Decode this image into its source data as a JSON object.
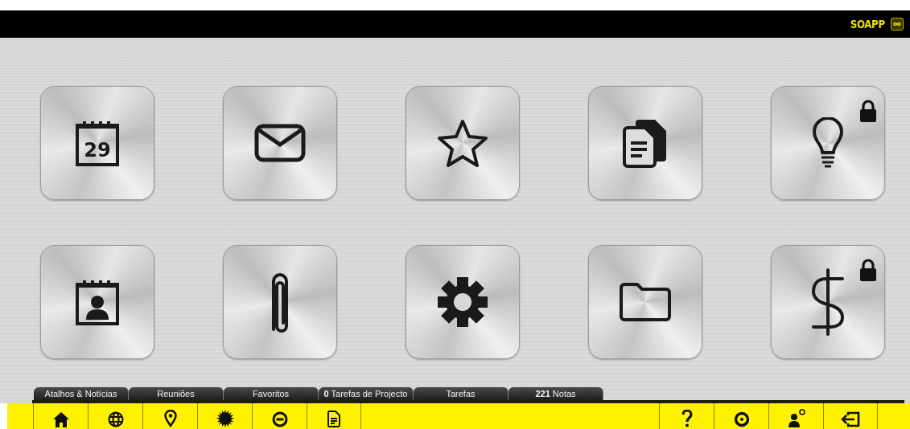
{
  "header": {
    "logo": "SOAPP"
  },
  "tiles": [
    {
      "kind": "calendar",
      "day": "29",
      "locked": false
    },
    {
      "kind": "mail",
      "locked": false
    },
    {
      "kind": "star",
      "locked": false
    },
    {
      "kind": "documents",
      "locked": false
    },
    {
      "kind": "bulb",
      "locked": true
    },
    {
      "kind": "contact",
      "locked": false
    },
    {
      "kind": "paperclip",
      "locked": false
    },
    {
      "kind": "gear",
      "locked": false
    },
    {
      "kind": "folder",
      "locked": false
    },
    {
      "kind": "dollar",
      "locked": true
    }
  ],
  "tabs": [
    {
      "label": "Atalhos & Notícias"
    },
    {
      "label": "Reuniões"
    },
    {
      "label": "Favoritos"
    },
    {
      "label": "**0** Tarefas de Projecto"
    },
    {
      "label": "Tarefas"
    },
    {
      "label": "**221** Notas"
    }
  ],
  "toolbar": {
    "left": [
      {
        "kind": "home"
      },
      {
        "kind": "globe"
      },
      {
        "kind": "pin"
      },
      {
        "kind": "burst"
      },
      {
        "kind": "minus"
      },
      {
        "kind": "document"
      }
    ],
    "right": [
      {
        "kind": "help"
      },
      {
        "kind": "target"
      },
      {
        "kind": "user-settings"
      },
      {
        "kind": "exit"
      }
    ]
  }
}
